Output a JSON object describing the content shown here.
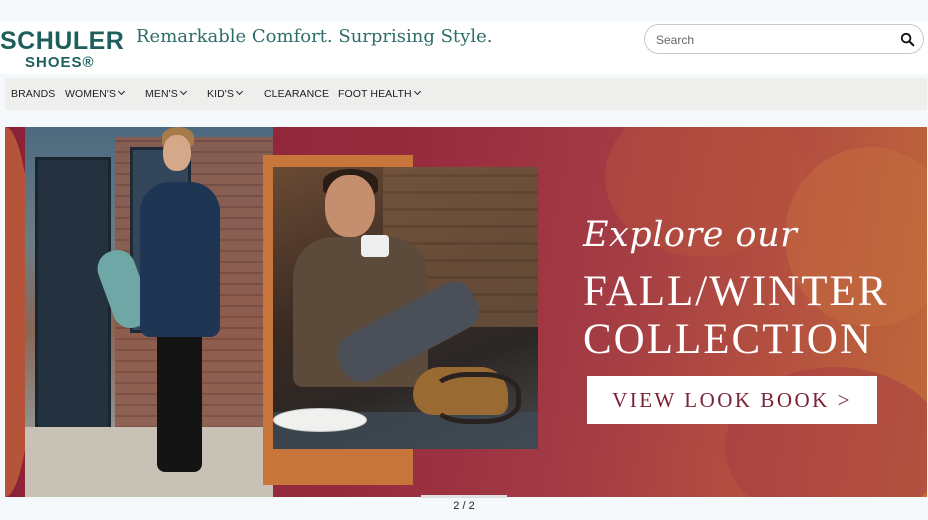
{
  "header": {
    "logo_main": "SCHULER",
    "logo_sub": "SHOES®",
    "tagline": "Remarkable Comfort. Surprising Style.",
    "search_placeholder": "Search",
    "search_icon": "search-icon"
  },
  "nav": {
    "items": [
      {
        "label": "BRANDS",
        "dropdown": false
      },
      {
        "label": "WOMEN'S",
        "dropdown": true
      },
      {
        "label": "MEN'S",
        "dropdown": true
      },
      {
        "label": "KID'S",
        "dropdown": true
      },
      {
        "label": "CLEARANCE",
        "dropdown": false
      },
      {
        "label": "FOOT HEALTH",
        "dropdown": true
      }
    ]
  },
  "hero": {
    "line1": "Explore our",
    "line2": "FALL/WINTER",
    "line3": "COLLECTION",
    "cta_label": "VIEW LOOK BOOK >",
    "background_color": "#962a3d",
    "cta_text_color": "#7c2237"
  },
  "carousel": {
    "counter": "2 / 2"
  },
  "colors": {
    "brand_teal": "#1e5f5c",
    "nav_background": "#eeeeec"
  }
}
